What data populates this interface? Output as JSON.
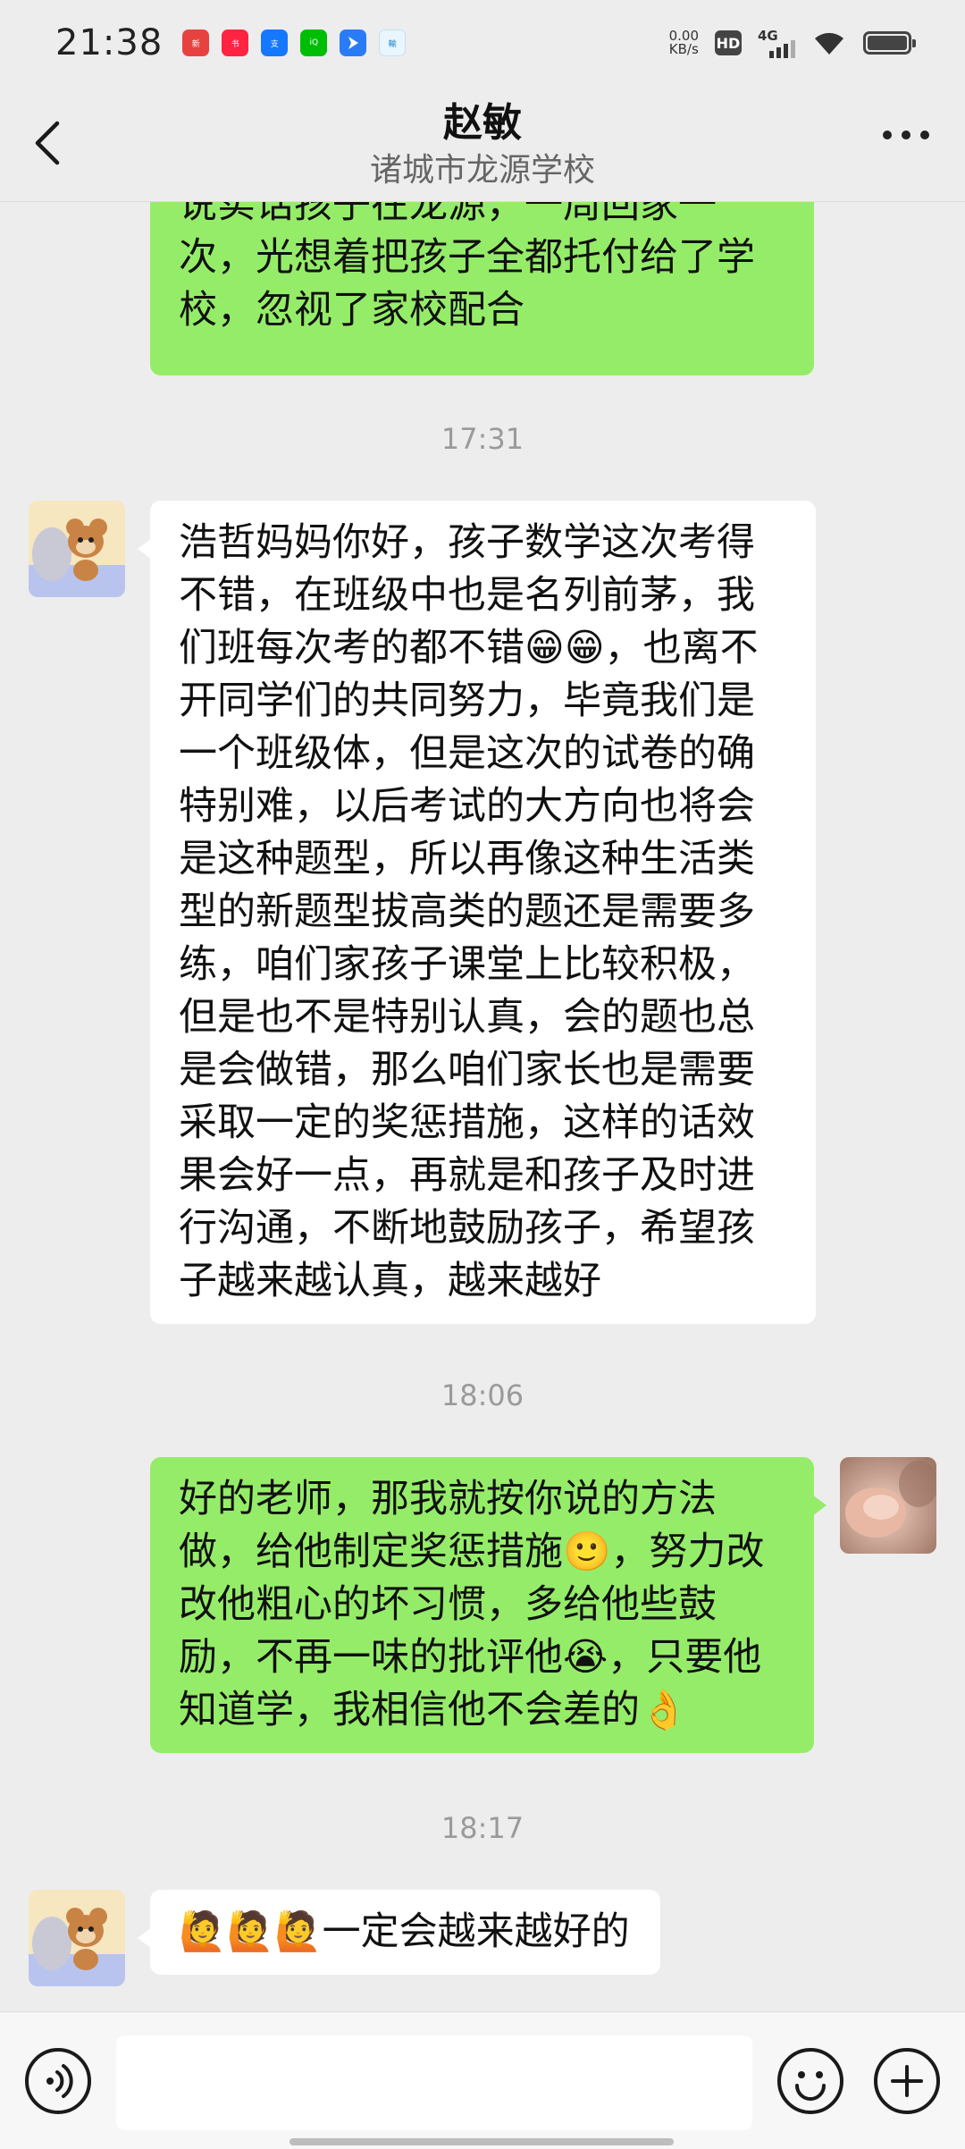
{
  "status_bar": {
    "time": "21:38",
    "net_speed_value": "0.00",
    "net_speed_unit": "KB/s",
    "hd_badge": "HD",
    "signal_label": "4G",
    "apps": [
      {
        "icon": "news-app-icon",
        "color": "#e64340"
      },
      {
        "icon": "xiaohongshu-icon",
        "color": "#ff2442"
      },
      {
        "icon": "alipay-icon",
        "color": "#1677ff"
      },
      {
        "icon": "iqiyi-icon",
        "color": "#00be06"
      },
      {
        "icon": "navigation-app-icon",
        "color": "#2a7cf6"
      },
      {
        "icon": "input-method-icon",
        "color": "#8fd3f4"
      }
    ]
  },
  "header": {
    "title": "赵敏",
    "subtitle": "诸城市龙源学校"
  },
  "messages": [
    {
      "side": "me",
      "text": "说实话孩子在龙源，一周回家一次，光想着把孩子全都托付给了学校，忽视了家校配合"
    },
    {
      "type": "time",
      "text": "17:31"
    },
    {
      "side": "them",
      "text": "浩哲妈妈你好，孩子数学这次考得不错，在班级中也是名列前茅，我们班每次考的都不错😁😁，也离不开同学们的共同努力，毕竟我们是一个班级体，但是这次的试卷的确特别难，以后考试的大方向也将会是这种题型，所以再像这种生活类型的新题型拔高类的题还是需要多练，咱们家孩子课堂上比较积极，但是也不是特别认真，会的题也总是会做错，那么咱们家长也是需要采取一定的奖惩措施，这样的话效果会好一点，再就是和孩子及时进行沟通，不断地鼓励孩子，希望孩子越来越认真，越来越好"
    },
    {
      "type": "time",
      "text": "18:06"
    },
    {
      "side": "me",
      "text": "好的老师，那我就按你说的方法做，给他制定奖惩措施🙂，努力改改他粗心的坏习惯，多给他些鼓励，不再一味的批评他😭，只要他知道学，我相信他不会差的👌"
    },
    {
      "type": "time",
      "text": "18:17"
    },
    {
      "side": "them",
      "text": "🙋🙋🙋一定会越来越好的"
    }
  ],
  "input_bar": {
    "placeholder": "",
    "voice_icon": "voice-icon",
    "emoji_icon": "emoji-icon",
    "plus_icon": "plus-icon"
  },
  "colors": {
    "my_bubble": "#95ec69",
    "their_bubble": "#ffffff",
    "background": "#ededed"
  }
}
